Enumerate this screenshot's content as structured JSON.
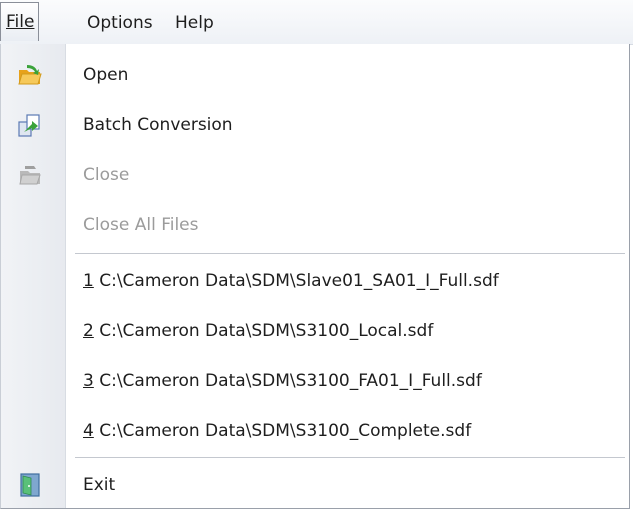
{
  "menubar": {
    "file_label": "File",
    "options_label": "Options",
    "help_label": "Help"
  },
  "file_menu": {
    "open_label": "Open",
    "batch_conversion_label": "Batch Conversion",
    "close_label": "Close",
    "close_all_label": "Close All Files",
    "recent_files": [
      {
        "num": "1",
        "path": " C:\\Cameron Data\\SDM\\Slave01_SA01_I_Full.sdf"
      },
      {
        "num": "2",
        "path": " C:\\Cameron Data\\SDM\\S3100_Local.sdf"
      },
      {
        "num": "3",
        "path": " C:\\Cameron Data\\SDM\\S3100_FA01_I_Full.sdf"
      },
      {
        "num": "4",
        "path": " C:\\Cameron Data\\SDM\\S3100_Complete.sdf"
      }
    ],
    "exit_label": "Exit"
  },
  "icons": {
    "open": "open-folder-icon",
    "batch": "batch-conversion-icon",
    "close": "close-folder-icon",
    "exit": "exit-door-icon"
  },
  "colors": {
    "disabled_text": "#9b9b9b",
    "text": "#1e1e1e",
    "gutter": "#e9ecf1",
    "open_icon": "#f2b632",
    "arrow_green": "#3aa23a"
  }
}
